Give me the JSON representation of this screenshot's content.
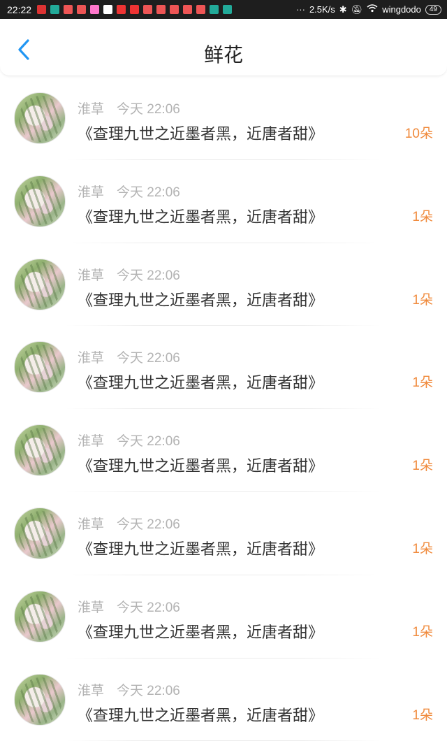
{
  "status_bar": {
    "time": "22:22",
    "network_speed": "2.5K/s",
    "wifi_name": "wingdodo",
    "battery": "49",
    "icon_colors": [
      "#d33",
      "#2a9",
      "#e55",
      "#e55",
      "#f7c",
      "#ffffff",
      "#e33",
      "#e33",
      "#e55",
      "#e55",
      "#e55",
      "#e55",
      "#e55",
      "#2a9",
      "#2a9"
    ]
  },
  "header": {
    "title": "鲜花"
  },
  "list": [
    {
      "name": "淮草",
      "time": "今天 22:06",
      "book": "《查理九世之近墨者黑，近唐者甜》",
      "count": "10朵"
    },
    {
      "name": "淮草",
      "time": "今天 22:06",
      "book": "《查理九世之近墨者黑，近唐者甜》",
      "count": "1朵"
    },
    {
      "name": "淮草",
      "time": "今天 22:06",
      "book": "《查理九世之近墨者黑，近唐者甜》",
      "count": "1朵"
    },
    {
      "name": "淮草",
      "time": "今天 22:06",
      "book": "《查理九世之近墨者黑，近唐者甜》",
      "count": "1朵"
    },
    {
      "name": "淮草",
      "time": "今天 22:06",
      "book": "《查理九世之近墨者黑，近唐者甜》",
      "count": "1朵"
    },
    {
      "name": "淮草",
      "time": "今天 22:06",
      "book": "《查理九世之近墨者黑，近唐者甜》",
      "count": "1朵"
    },
    {
      "name": "淮草",
      "time": "今天 22:06",
      "book": "《查理九世之近墨者黑，近唐者甜》",
      "count": "1朵"
    },
    {
      "name": "淮草",
      "time": "今天 22:06",
      "book": "《查理九世之近墨者黑，近唐者甜》",
      "count": "1朵"
    }
  ],
  "colors": {
    "accent": "#2196f3",
    "count": "#f08a3c",
    "meta": "#b3b3b3"
  }
}
